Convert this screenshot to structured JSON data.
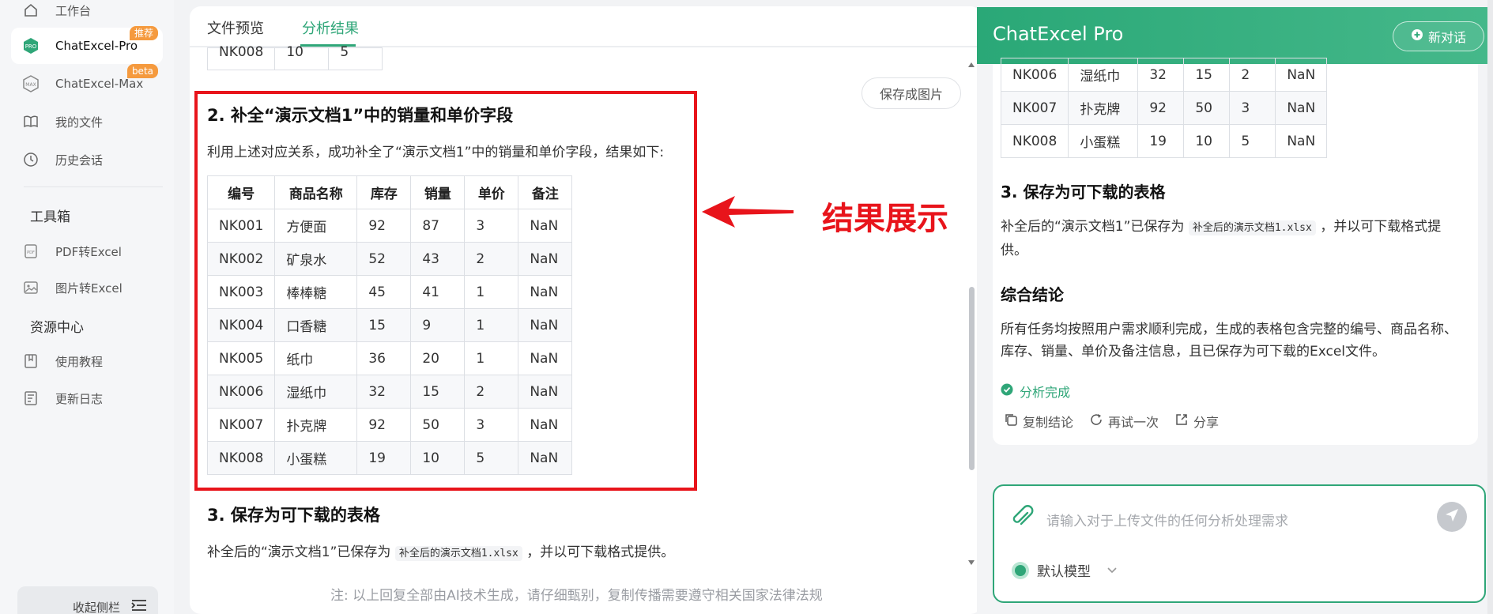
{
  "sidebar": {
    "items": [
      {
        "label": "工作台",
        "icon": "home-icon"
      },
      {
        "label": "ChatExcel-Pro",
        "icon": "pro-icon",
        "badge": "推荐"
      },
      {
        "label": "ChatExcel-Max",
        "icon": "max-icon",
        "badge": "beta"
      },
      {
        "label": "我的文件",
        "icon": "book-icon"
      },
      {
        "label": "历史会话",
        "icon": "clock-icon"
      }
    ],
    "toolbox_title": "工具箱",
    "tools": [
      {
        "label": "PDF转Excel",
        "icon": "pdf-icon"
      },
      {
        "label": "图片转Excel",
        "icon": "image-icon"
      }
    ],
    "resources_title": "资源中心",
    "resources": [
      {
        "label": "使用教程",
        "icon": "bookmark-icon"
      },
      {
        "label": "更新日志",
        "icon": "document-icon"
      }
    ],
    "collapse_label": "收起侧栏"
  },
  "main": {
    "tabs": [
      {
        "label": "文件预览"
      },
      {
        "label": "分析结果"
      }
    ],
    "active_tab": 1,
    "save_image_label": "保存成图片",
    "top_row": [
      "NK008",
      "10",
      "5"
    ],
    "section2_title": "2. 补全“演示文档1”中的销量和单价字段",
    "section2_text": "利用上述对应关系，成功补全了“演示文档1”中的销量和单价字段，结果如下:",
    "table": {
      "headers": [
        "编号",
        "商品名称",
        "库存",
        "销量",
        "单价",
        "备注"
      ],
      "rows": [
        [
          "NK001",
          "方便面",
          "92",
          "87",
          "3",
          "NaN"
        ],
        [
          "NK002",
          "矿泉水",
          "52",
          "43",
          "2",
          "NaN"
        ],
        [
          "NK003",
          "棒棒糖",
          "45",
          "41",
          "1",
          "NaN"
        ],
        [
          "NK004",
          "口香糖",
          "15",
          "9",
          "1",
          "NaN"
        ],
        [
          "NK005",
          "纸巾",
          "36",
          "20",
          "1",
          "NaN"
        ],
        [
          "NK006",
          "湿纸巾",
          "32",
          "15",
          "2",
          "NaN"
        ],
        [
          "NK007",
          "扑克牌",
          "92",
          "50",
          "3",
          "NaN"
        ],
        [
          "NK008",
          "小蛋糕",
          "19",
          "10",
          "5",
          "NaN"
        ]
      ]
    },
    "annotation_label": "结果展示",
    "section3_title": "3. 保存为可下载的表格",
    "section3_pre": "补全后的“演示文档1”已保存为",
    "section3_code": "补全后的演示文档1.xlsx",
    "section3_post": "，并以可下载格式提供。",
    "footer_note": "注: 以上回复全部由AI技术生成，请仔细甄别，复制传播需要遵守相关国家法律法规"
  },
  "chat": {
    "title": "ChatExcel Pro",
    "new_chat_label": "新对话",
    "table_rows": [
      [
        "NK006",
        "湿纸巾",
        "32",
        "15",
        "2",
        "NaN"
      ],
      [
        "NK007",
        "扑克牌",
        "92",
        "50",
        "3",
        "NaN"
      ],
      [
        "NK008",
        "小蛋糕",
        "19",
        "10",
        "5",
        "NaN"
      ]
    ],
    "section3_title": "3. 保存为可下载的表格",
    "section3_pre": "补全后的“演示文档1”已保存为",
    "section3_code": "补全后的演示文档1.xlsx",
    "section3_post": "，并以可下载格式提供。",
    "conclusion_title": "综合结论",
    "conclusion_text": "所有任务均按照用户需求顺利完成，生成的表格包含完整的编号、商品名称、库存、销量、单价及备注信息，且已保存为可下载的Excel文件。",
    "status": "分析完成",
    "actions": [
      {
        "label": "复制结论",
        "icon": "copy-icon"
      },
      {
        "label": "再试一次",
        "icon": "refresh-icon"
      },
      {
        "label": "分享",
        "icon": "share-icon"
      }
    ],
    "input_placeholder": "请输入对于上传文件的任何分析处理需求",
    "model_label": "默认模型"
  },
  "colors": {
    "accent": "#2fa678",
    "annotation": "#e8141b",
    "badge": "#f59a3e"
  }
}
